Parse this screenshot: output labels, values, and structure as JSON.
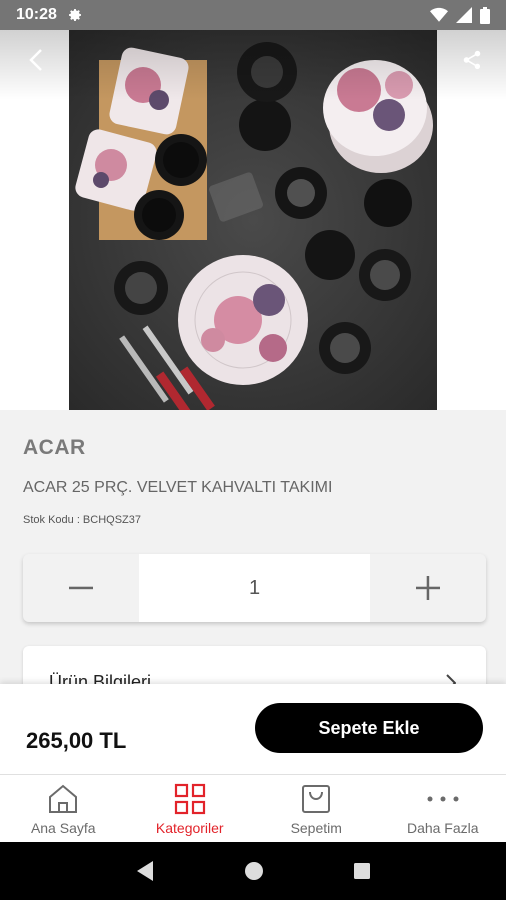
{
  "status_bar": {
    "time": "10:28"
  },
  "product": {
    "brand": "ACAR",
    "title": "ACAR 25 PRÇ. VELVET KAHVALTI TAKIMI",
    "stock_code": "Stok Kodu : BCHQSZ37",
    "quantity": "1",
    "info_section_label": "Ürün Bilgileri",
    "price": "265,00 TL",
    "add_to_cart_label": "Sepete Ekle"
  },
  "bottom_nav": {
    "items": [
      {
        "label": "Ana Sayfa",
        "icon": "home-icon"
      },
      {
        "label": "Kategoriler",
        "icon": "grid-icon"
      },
      {
        "label": "Sepetim",
        "icon": "bag-icon"
      },
      {
        "label": "Daha Fazla",
        "icon": "more-icon"
      }
    ],
    "active_index": 1
  },
  "colors": {
    "accent": "#e2232a",
    "button": "#000000"
  }
}
